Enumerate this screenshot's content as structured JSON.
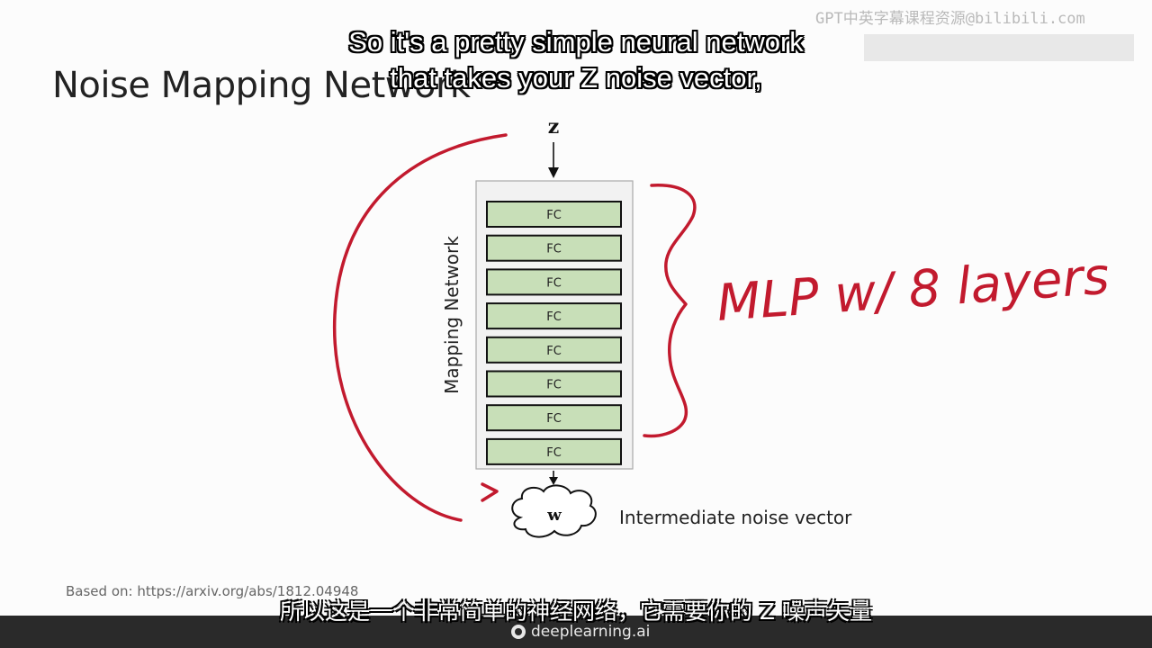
{
  "slide": {
    "title": "Noise Mapping Network",
    "source_note": "Based on: https://arxiv.org/abs/1812.04948"
  },
  "diagram": {
    "input_label": "z",
    "block_label": "Mapping Network",
    "layers": [
      "FC",
      "FC",
      "FC",
      "FC",
      "FC",
      "FC",
      "FC",
      "FC"
    ],
    "output_label": "w",
    "output_caption": "Intermediate noise vector",
    "annotation": "MLP w/ 8 layers",
    "layer_color": "#c8dfb8",
    "annotation_color": "#c21a2e"
  },
  "subtitles": {
    "en_line1": "So it's a pretty simple neural network",
    "en_line2": "that takes your Z noise vector,",
    "cn": "所以这是一个非常简单的神经网络，它需要你的 Z 噪声矢量"
  },
  "watermark": "GPT中英字幕课程资源@bilibili.com",
  "brand": "deeplearning.ai"
}
